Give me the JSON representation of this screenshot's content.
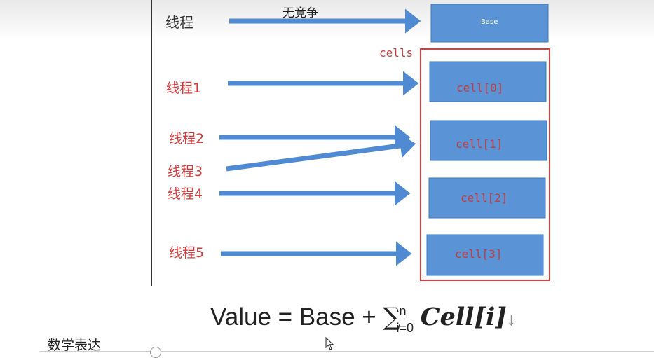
{
  "diagram": {
    "thread_main": "线程",
    "no_contention": "无竞争",
    "base_label": "Base",
    "cells_label": "cells",
    "threads": [
      "线程1",
      "线程2",
      "线程3",
      "线程4",
      "线程5"
    ],
    "cells": [
      "cell[0]",
      "cell[1]",
      "cell[2]",
      "cell[3]"
    ],
    "colors": {
      "box": "#5a93d6",
      "arrow": "#4f8ad3",
      "cells_border": "#e03a3a",
      "label_red": "#d23a3a"
    }
  },
  "formula": {
    "lhs": "Value = Base + ",
    "sum": "∑",
    "sup": "n",
    "sub": "i=0",
    "cell": "Cell[i]",
    "tail": "↓"
  },
  "footer": {
    "label": "数学表达"
  }
}
